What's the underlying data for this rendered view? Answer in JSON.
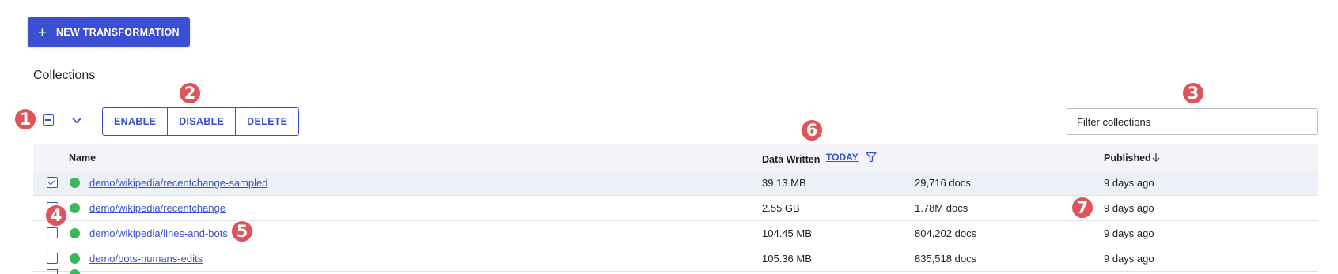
{
  "new_button": {
    "label": "NEW TRANSFORMATION"
  },
  "section_title": "Collections",
  "actions": {
    "enable": "ENABLE",
    "disable": "DISABLE",
    "delete": "DELETE"
  },
  "filter": {
    "placeholder": "Filter collections"
  },
  "table": {
    "headers": {
      "name": "Name",
      "data_written": "Data Written",
      "today": "TODAY",
      "published": "Published"
    },
    "rows": [
      {
        "name": "demo/wikipedia/recentchange-sampled",
        "bytes": "39.13 MB",
        "docs": "29,716 docs",
        "published": "9 days ago",
        "checked": true
      },
      {
        "name": "demo/wikipedia/recentchange",
        "bytes": "2.55 GB",
        "docs": "1.78M docs",
        "published": "9 days ago",
        "checked": false
      },
      {
        "name": "demo/wikipedia/lines-and-bots",
        "bytes": "104.45 MB",
        "docs": "804,202 docs",
        "published": "9 days ago",
        "checked": false
      },
      {
        "name": "demo/bots-humans-edits",
        "bytes": "105.36 MB",
        "docs": "835,518 docs",
        "published": "9 days ago",
        "checked": false
      }
    ]
  },
  "markers": [
    "1",
    "2",
    "3",
    "4",
    "5",
    "6",
    "7"
  ],
  "colors": {
    "accent": "#3a4fd1",
    "status_ok": "#3bb85a",
    "marker": "#e0535a"
  }
}
